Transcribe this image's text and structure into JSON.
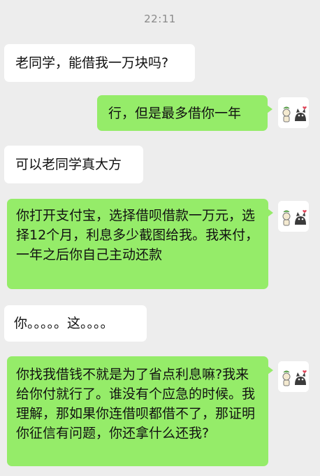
{
  "timestamp": "22:11",
  "messages": [
    {
      "side": "in",
      "text": "老同学，能借我一万块吗?"
    },
    {
      "side": "out",
      "text": "行，但是最多借你一年"
    },
    {
      "side": "in",
      "text": "可以老同学真大方"
    },
    {
      "side": "out",
      "text": "你打开支付宝，选择借呗借款一万元，选择12个月，利息多少截图给我。我来付，一年之后你自己主动还款"
    },
    {
      "side": "in",
      "text": "你。。。。。这。。。。"
    },
    {
      "side": "out",
      "text": "你找我借钱不就是为了省点利息嘛?我来给你付就行了。谁没有个应急的时候。我理解，那如果你连借呗都借不了，那证明你征信有问题，你还拿什么还我?"
    }
  ],
  "avatar_icon": "cat-and-figure-avatar-icon",
  "colors": {
    "background": "#ededed",
    "incoming_bubble": "#ffffff",
    "outgoing_bubble": "#95ec69",
    "timestamp_text": "#8a8a8a"
  }
}
